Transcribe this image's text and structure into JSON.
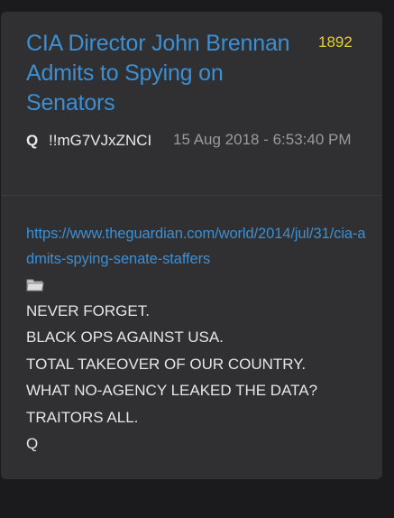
{
  "post": {
    "title": "CIA Director John Brennan Admits to Spying on Senators",
    "number": "1892",
    "author": "Q",
    "tripcode": "!!mG7VJxZNCI",
    "timestamp": "15 Aug 2018 - 6:53:40 PM",
    "link": "https://www.theguardian.com/world/2014/jul/31/cia-admits-spying-senate-staffers",
    "link_icon": "folder-icon",
    "lines": [
      "NEVER FORGET.",
      "BLACK OPS AGAINST USA.",
      "TOTAL TAKEOVER OF OUR COUNTRY.",
      "WHAT NO-AGENCY LEAKED THE DATA?",
      "TRAITORS ALL.",
      "Q"
    ]
  },
  "colors": {
    "page_background": "#1b1b1d",
    "card_background": "#303033",
    "title_link": "#3d8fd1",
    "post_number": "#e6d02a",
    "text": "#e6e6e6",
    "timestamp": "#9a9a9e"
  }
}
